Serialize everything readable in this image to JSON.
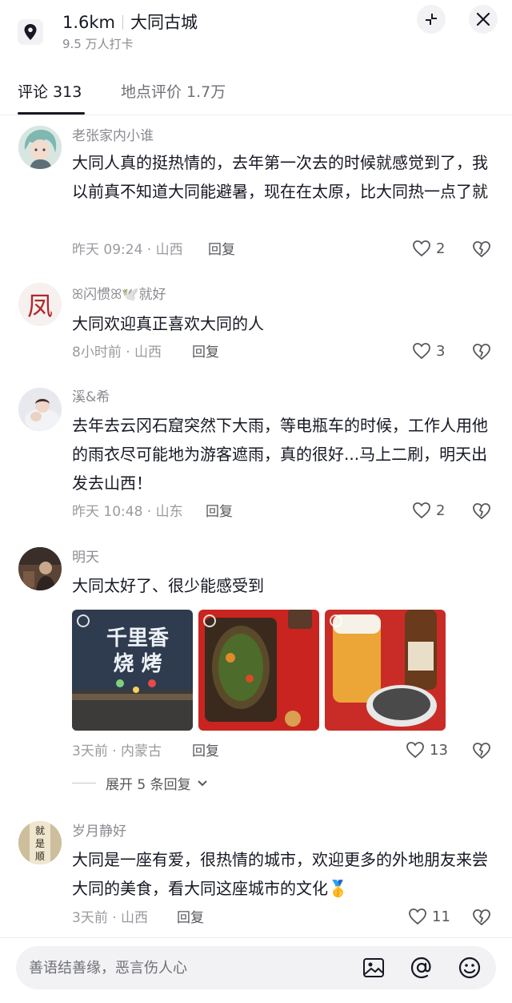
{
  "header": {
    "distance": "1.6km",
    "place": "大同古城",
    "checkins": "9.5 万人打卡",
    "location_icon": "location-pin-icon",
    "collapse_icon": "collapse-icon",
    "close_icon": "close-icon"
  },
  "tabs": [
    {
      "label": "评论 313",
      "active": true
    },
    {
      "label": "地点评价 1.7万",
      "active": false
    }
  ],
  "comments": [
    {
      "user": "老张家内小谁",
      "text": "大同人真的挺热情的，去年第一次去的时候就感觉到了，我以前真不知道大同能避暑，现在在太原，比大同热一点了就",
      "meta": "昨天 09:24 · 山西",
      "reply": "回复",
      "likes": "2"
    },
    {
      "user": "ꕤ闪惯ꕤ🕊️就好",
      "text": "大同欢迎真正喜欢大同的人",
      "meta": "8小时前 · 山西",
      "reply": "回复",
      "likes": "3"
    },
    {
      "user": "溪&希",
      "text": "去年去云冈石窟突然下大雨，等电瓶车的时候，工作人用他的雨衣尽可能地为游客遮雨，真的很好...马上二刷，明天出发去山西！",
      "meta": "昨天 10:48 · 山东",
      "reply": "回复",
      "likes": "2"
    },
    {
      "user": "明天",
      "text": "大同太好了、很少能感受到",
      "meta": "3天前 · 内蒙古",
      "reply": "回复",
      "likes": "13",
      "photos": [
        {
          "sign_line1": "千里香",
          "sign_line2": "烧 烤"
        },
        {
          "desc": "grilled-fish"
        },
        {
          "desc": "beer-and-seeds"
        }
      ],
      "expand_label": "展开 5 条回复"
    },
    {
      "user": "岁月静好",
      "avatar_text": "就是顺",
      "text": "大同是一座有爱，很热情的城市，欢迎更多的外地朋友来尝大同的美食，看大同这座城市的文化🥇",
      "meta": "3天前 · 山西",
      "reply": "回复",
      "likes": "11"
    }
  ],
  "input": {
    "placeholder": "善语结善缘，恶言伤人心",
    "image_icon": "image-icon",
    "mention_icon": "at-mention-icon",
    "emoji_icon": "emoji-icon"
  },
  "colors": {
    "text_primary": "#161823",
    "text_secondary": "#8a8b91",
    "background": "#ffffff",
    "input_bg": "#f2f2f4"
  }
}
